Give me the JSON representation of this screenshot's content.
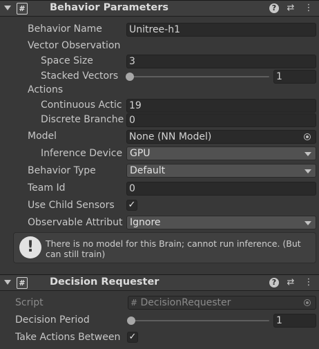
{
  "components": [
    {
      "title": "Behavior Parameters",
      "icon": "#",
      "fields": {
        "behavior_name_label": "Behavior Name",
        "behavior_name_value": "Unitree-h1",
        "vector_observation_label": "Vector Observation",
        "space_size_label": "Space Size",
        "space_size_value": "3",
        "stacked_vectors_label": "Stacked Vectors",
        "stacked_vectors_value": "1",
        "actions_label": "Actions",
        "continuous_actions_label": "Continuous Actic",
        "continuous_actions_value": "19",
        "discrete_branches_label": "Discrete Branche",
        "discrete_branches_value": "0",
        "model_label": "Model",
        "model_value": "None (NN Model)",
        "inference_device_label": "Inference Device",
        "inference_device_value": "GPU",
        "behavior_type_label": "Behavior Type",
        "behavior_type_value": "Default",
        "team_id_label": "Team Id",
        "team_id_value": "0",
        "use_child_sensors_label": "Use Child Sensors",
        "use_child_sensors_checked": true,
        "observable_attribute_label": "Observable Attribut",
        "observable_attribute_value": "Ignore"
      },
      "help_box": {
        "icon": "!",
        "text": "There is no model for this Brain; cannot run inference. (But can still train)"
      }
    },
    {
      "title": "Decision Requester",
      "icon": "#",
      "fields": {
        "script_label": "Script",
        "script_value": "DecisionRequester",
        "decision_period_label": "Decision Period",
        "decision_period_value": "1",
        "take_actions_label": "Take Actions Between",
        "take_actions_checked": true
      }
    }
  ],
  "icons": {
    "help": "help-icon",
    "presets": "presets-icon",
    "menu": "kebab-menu-icon",
    "check": "✓"
  },
  "colors": {
    "background": "#383838",
    "header": "#3e3e3e",
    "field": "#2a2a2a",
    "dropdown": "#515151",
    "text": "#c8c8c8"
  }
}
